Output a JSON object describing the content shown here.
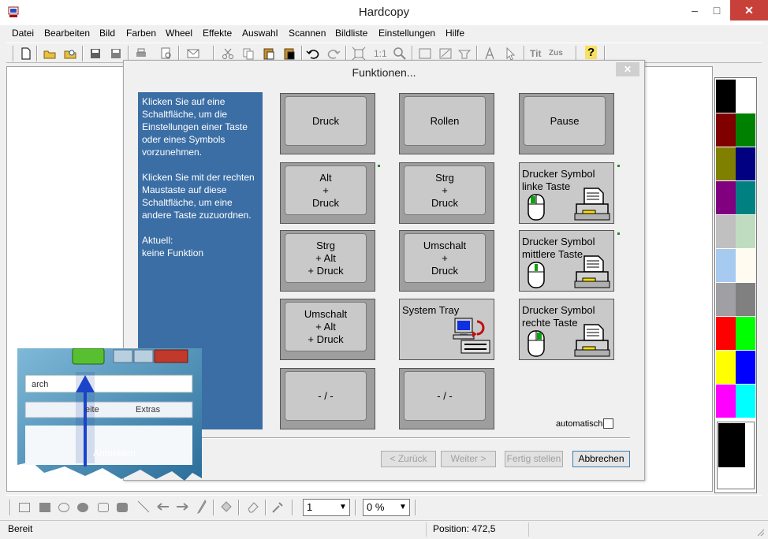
{
  "window": {
    "title": "Hardcopy",
    "minimize": "–",
    "maximize": "□",
    "close": "✕"
  },
  "menu": [
    "Datei",
    "Bearbeiten",
    "Bild",
    "Farben",
    "Wheel",
    "Effekte",
    "Auswahl",
    "Scannen",
    "Bildliste",
    "Einstellungen",
    "Hilfe"
  ],
  "toolbar": {
    "one_to_one": "1:1",
    "tit": "Tit",
    "zus": "Zus",
    "help": "?"
  },
  "dialog": {
    "title": "Funktionen...",
    "close": "✕",
    "info": {
      "p1": "Klicken Sie auf eine Schaltfläche, um die Einstellungen einer Taste oder eines Symbols vorzunehmen.",
      "p2": "Klicken Sie mit der rechten Maustaste auf diese Schaltfläche, um eine andere Taste zuzuordnen.",
      "p3_label": "Aktuell:",
      "p3_value": "keine Funktion"
    },
    "keys": {
      "druck": "Druck",
      "rollen": "Rollen",
      "pause": "Pause",
      "alt_druck": "Alt\n+\nDruck",
      "strg_druck": "Strg\n+\nDruck",
      "drucker_links": "Drucker Symbol\nlinke Taste",
      "strg_alt_druck": "Strg\n+ Alt\n+ Druck",
      "umschalt_druck": "Umschalt\n+\nDruck",
      "drucker_mitte": "Drucker Symbol\nmittlere Taste",
      "umschalt_alt_druck": "Umschalt\n+ Alt\n+ Druck",
      "system_tray": "System Tray",
      "drucker_rechts": "Drucker Symbol\nrechte Taste",
      "empty1": "- / -",
      "empty2": "- / -"
    },
    "automatisch": "automatisch",
    "buttons": {
      "back": "< Zurück",
      "next": "Weiter >",
      "finish": "Fertig stellen",
      "cancel": "Abbrechen"
    }
  },
  "drawbar": {
    "line_width": "1",
    "percent": "0 %"
  },
  "status": {
    "left": "Bereit",
    "position": "Position: 472,5"
  },
  "overlay": {
    "search": "arch",
    "seite": "eite",
    "extras": "Extras",
    "anmelden": "Anmelden"
  },
  "palette_colors": [
    "#000000",
    "#ffffff",
    "#800000",
    "#008000",
    "#808000",
    "#000080",
    "#800080",
    "#008080",
    "#c0c0c0",
    "#c0dcc0",
    "#a6caf0",
    "#fffbf0",
    "#a0a0a4",
    "#808080",
    "#ff0000",
    "#00ff00",
    "#ffff00",
    "#0000ff",
    "#ff00ff",
    "#00ffff"
  ]
}
